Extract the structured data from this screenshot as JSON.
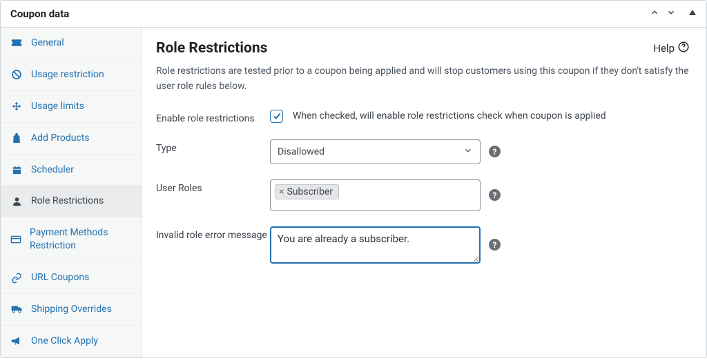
{
  "panel": {
    "title": "Coupon data"
  },
  "sidebar": {
    "items": [
      {
        "label": "General"
      },
      {
        "label": "Usage restriction"
      },
      {
        "label": "Usage limits"
      },
      {
        "label": "Add Products"
      },
      {
        "label": "Scheduler"
      },
      {
        "label": "Role Restrictions"
      },
      {
        "label": "Payment Methods Restriction"
      },
      {
        "label": "URL Coupons"
      },
      {
        "label": "Shipping Overrides"
      },
      {
        "label": "One Click Apply"
      }
    ]
  },
  "content": {
    "title": "Role Restrictions",
    "help_label": "Help",
    "description": "Role restrictions are tested prior to a coupon being applied and will stop customers using this coupon if they don't satisfy the user role rules below.",
    "fields": {
      "enable": {
        "label": "Enable role restrictions",
        "check_label": "When checked, will enable role restrictions check when coupon is applied",
        "checked": true
      },
      "type": {
        "label": "Type",
        "selected": "Disallowed"
      },
      "roles": {
        "label": "User Roles",
        "tags": [
          "Subscriber"
        ]
      },
      "message": {
        "label": "Invalid role error message",
        "value": "You are already a subscriber."
      }
    }
  }
}
